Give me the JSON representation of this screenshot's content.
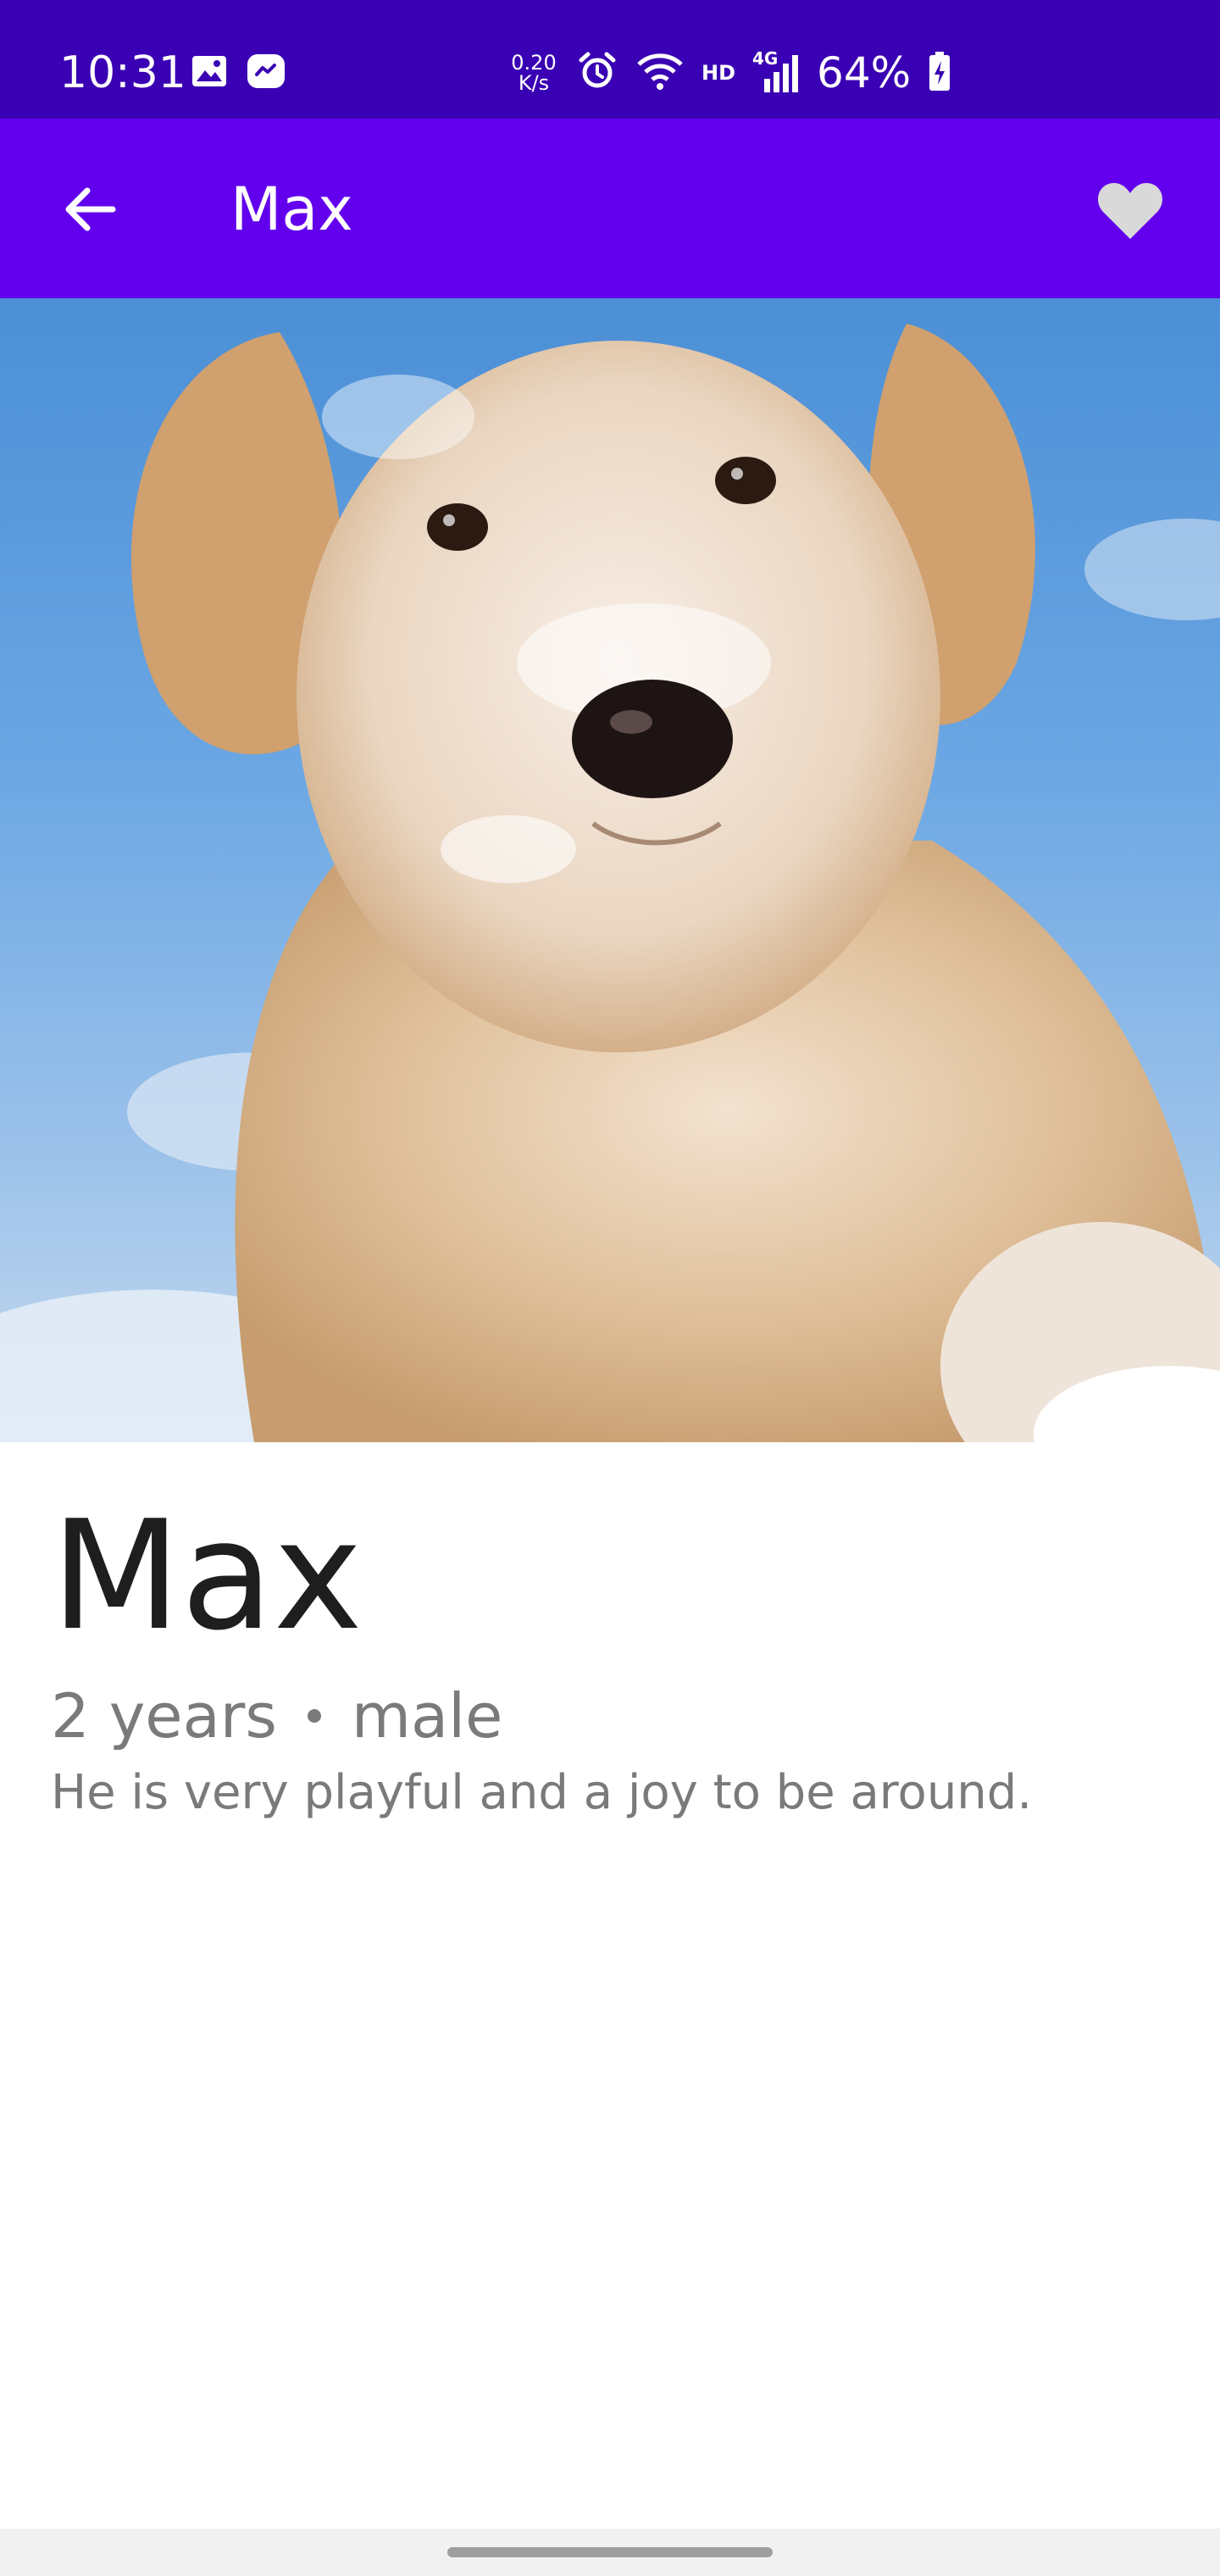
{
  "status_bar": {
    "time": "10:31",
    "net_speed_value": "0.20",
    "net_speed_unit": "K/s",
    "hd_label": "HD",
    "network_type": "4G",
    "battery_percent": "64%",
    "icons": [
      "gallery-icon",
      "messenger-icon",
      "alarm-icon",
      "wifi-icon",
      "signal-icon",
      "battery-charging-icon"
    ]
  },
  "app_bar": {
    "title": "Max",
    "back_icon": "arrow-back-icon",
    "favorite_icon": "heart-icon",
    "background_color": "#6200ee",
    "favorite_color": "#d9d9d9"
  },
  "pet": {
    "photo_subject": "golden retriever puppy in snow",
    "name": "Max",
    "age": "2 years",
    "gender": "male",
    "description": "He is very playful and a joy to be around."
  },
  "colors": {
    "status_bar": "#3a00b3",
    "primary_text": "#1e1e1e",
    "secondary_text": "#7a7a7a"
  }
}
